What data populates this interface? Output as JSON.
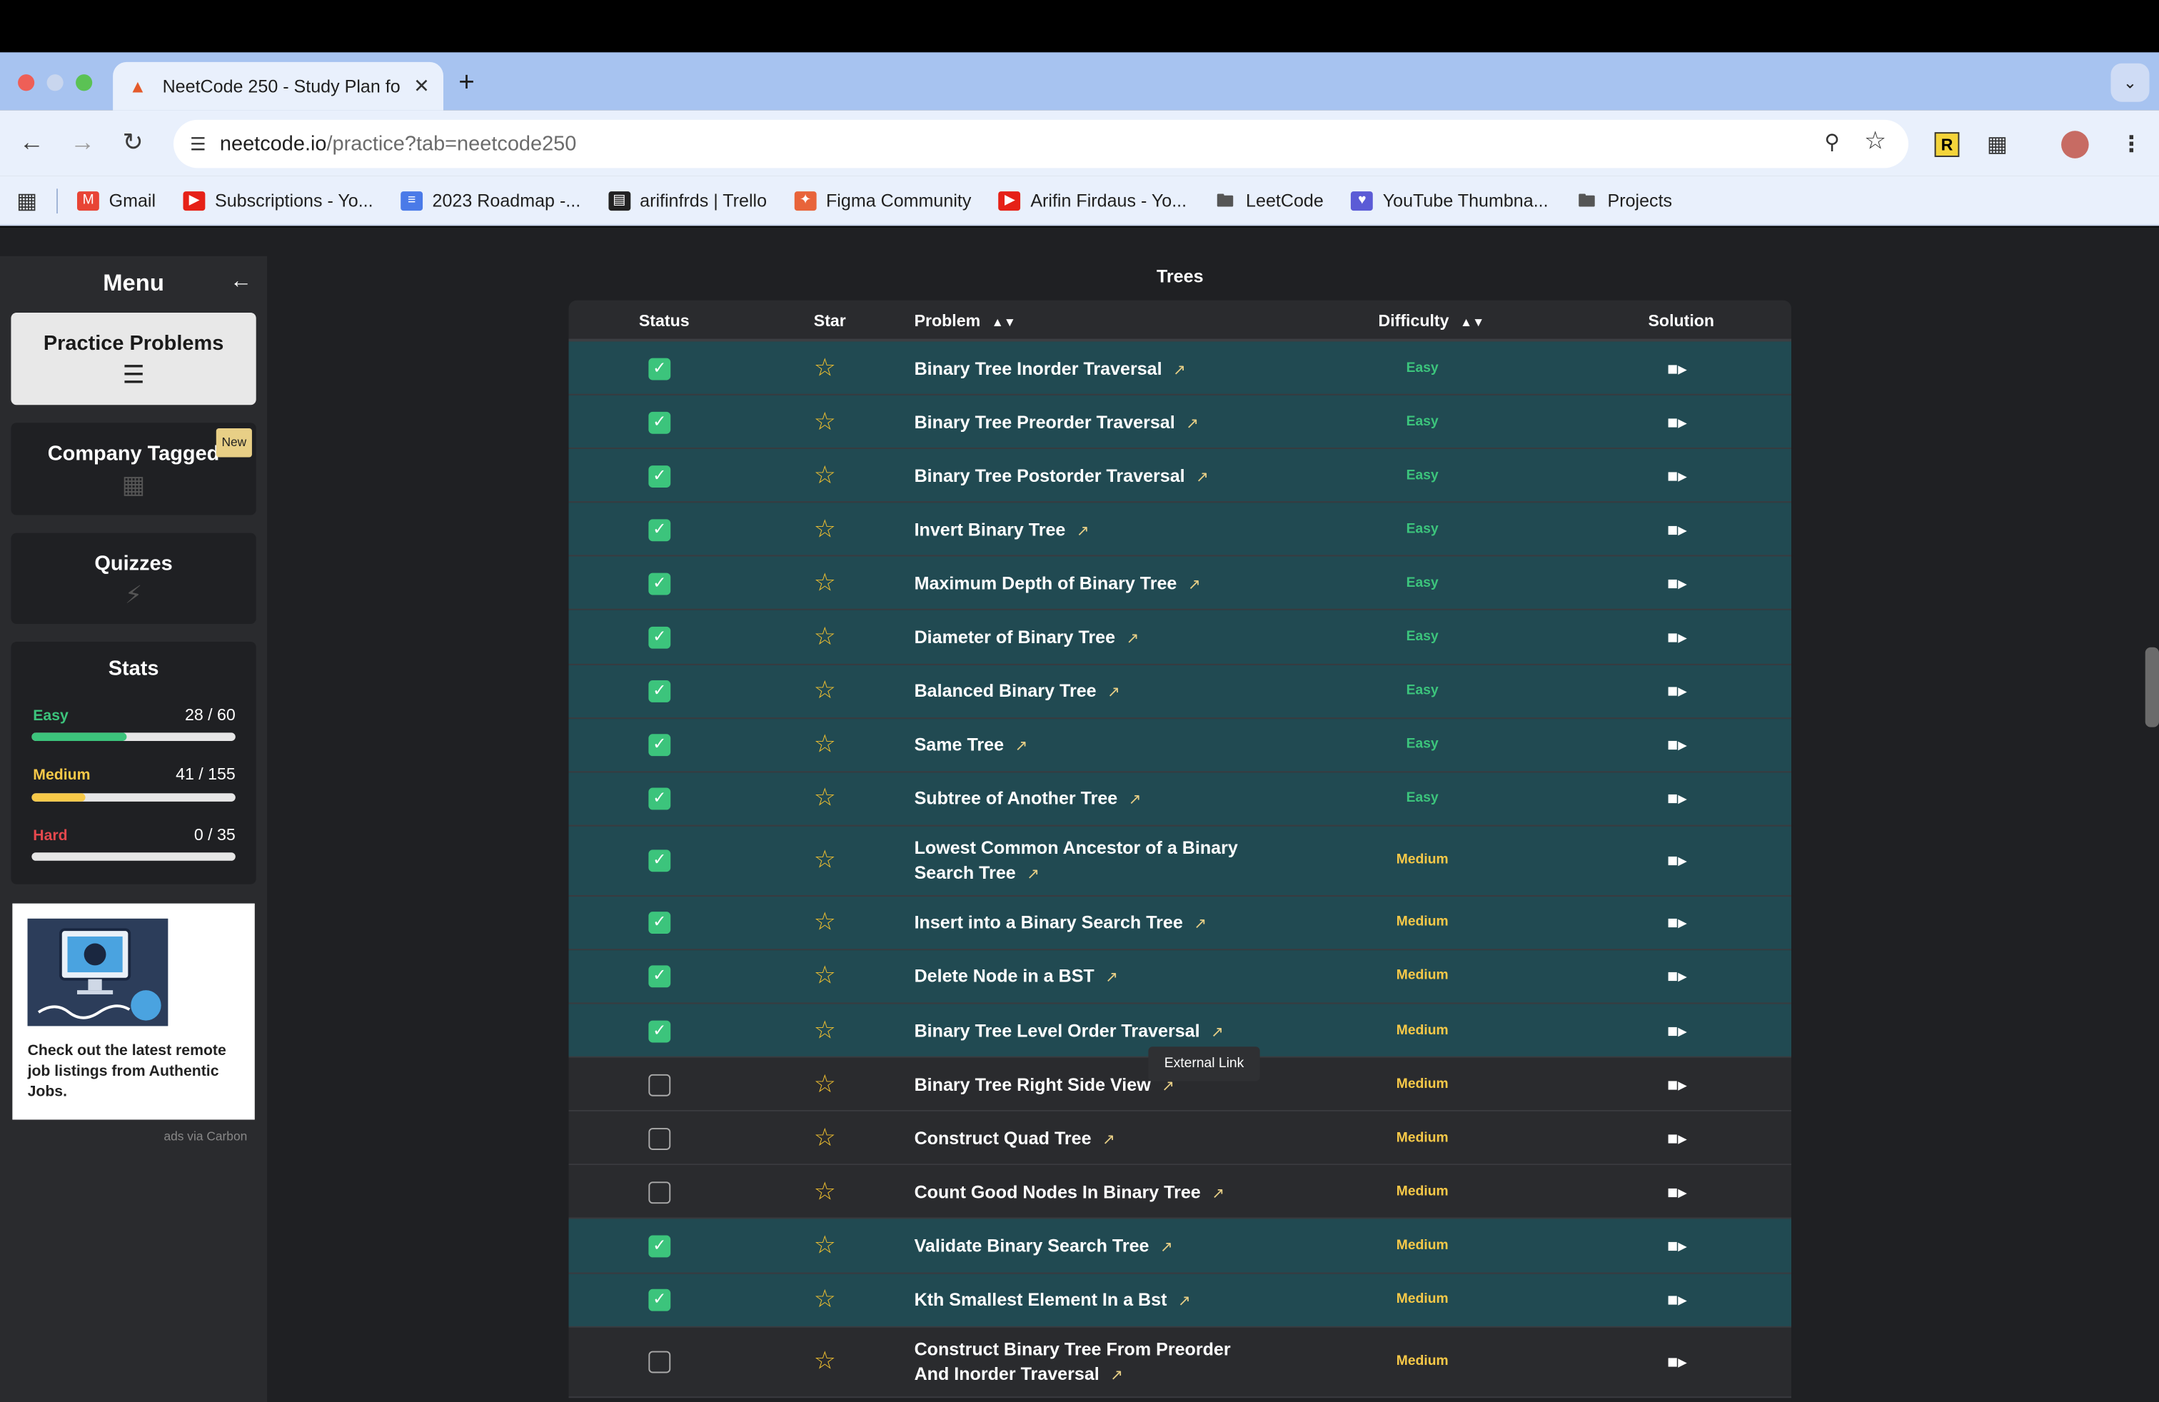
{
  "browser": {
    "tab_title": "NeetCode 250 - Study Plan fo",
    "url_domain": "neetcode.io",
    "url_path": "/practice?tab=neetcode250",
    "bookmarks": [
      {
        "label": "Gmail",
        "icon": "gmail-icon",
        "color": "#e84435"
      },
      {
        "label": "Subscriptions - Yo...",
        "icon": "youtube-icon",
        "color": "#e62117"
      },
      {
        "label": "2023 Roadmap -...",
        "icon": "docs-icon",
        "color": "#4a7ae8"
      },
      {
        "label": "arifinfrds | Trello",
        "icon": "trello-icon",
        "color": "#222"
      },
      {
        "label": "Figma Community",
        "icon": "figma-icon",
        "color": "#e8643a"
      },
      {
        "label": "Arifin Firdaus - Yo...",
        "icon": "youtube-icon",
        "color": "#e62117"
      },
      {
        "label": "LeetCode",
        "icon": "folder-icon",
        "color": "#555"
      },
      {
        "label": "YouTube Thumbna...",
        "icon": "heart-icon",
        "color": "#5b5bd6"
      },
      {
        "label": "Projects",
        "icon": "folder-icon",
        "color": "#555"
      }
    ]
  },
  "sidebar": {
    "title": "Menu",
    "items": [
      {
        "label": "Practice Problems",
        "icon": "list-icon"
      },
      {
        "label": "Company Tagged",
        "icon": "building-icon",
        "badge": "New"
      },
      {
        "label": "Quizzes",
        "icon": "lightning-icon"
      }
    ],
    "stats": {
      "title": "Stats",
      "easy": {
        "label": "Easy",
        "count": "28 / 60",
        "solved": 28,
        "total": 60,
        "color": "#3cc47c"
      },
      "medium": {
        "label": "Medium",
        "count": "41 / 155",
        "solved": 41,
        "total": 155,
        "color": "#f7c948"
      },
      "hard": {
        "label": "Hard",
        "count": "0 / 35",
        "solved": 0,
        "total": 35,
        "color": "#e5484d"
      }
    },
    "ad": {
      "text": "Check out the latest remote job listings from Authentic Jobs.",
      "credit": "ads via Carbon"
    }
  },
  "table": {
    "section_title": "Trees",
    "headers": {
      "status": "Status",
      "star": "Star",
      "problem": "Problem",
      "difficulty": "Difficulty",
      "solution": "Solution"
    },
    "rows": [
      {
        "problem": "Binary Tree Inorder Traversal",
        "difficulty": "Easy",
        "done": true
      },
      {
        "problem": "Binary Tree Preorder Traversal",
        "difficulty": "Easy",
        "done": true
      },
      {
        "problem": "Binary Tree Postorder Traversal",
        "difficulty": "Easy",
        "done": true
      },
      {
        "problem": "Invert Binary Tree",
        "difficulty": "Easy",
        "done": true
      },
      {
        "problem": "Maximum Depth of Binary Tree",
        "difficulty": "Easy",
        "done": true
      },
      {
        "problem": "Diameter of Binary Tree",
        "difficulty": "Easy",
        "done": true
      },
      {
        "problem": "Balanced Binary Tree",
        "difficulty": "Easy",
        "done": true
      },
      {
        "problem": "Same Tree",
        "difficulty": "Easy",
        "done": true
      },
      {
        "problem": "Subtree of Another Tree",
        "difficulty": "Easy",
        "done": true
      },
      {
        "problem": "Lowest Common Ancestor of a Binary Search Tree",
        "difficulty": "Medium",
        "done": true,
        "tall": true
      },
      {
        "problem": "Insert into a Binary Search Tree",
        "difficulty": "Medium",
        "done": true
      },
      {
        "problem": "Delete Node in a BST",
        "difficulty": "Medium",
        "done": true
      },
      {
        "problem": "Binary Tree Level Order Traversal",
        "difficulty": "Medium",
        "done": true
      },
      {
        "problem": "Binary Tree Right Side View",
        "difficulty": "Medium",
        "done": false
      },
      {
        "problem": "Construct Quad Tree",
        "difficulty": "Medium",
        "done": false
      },
      {
        "problem": "Count Good Nodes In Binary Tree",
        "difficulty": "Medium",
        "done": false
      },
      {
        "problem": "Validate Binary Search Tree",
        "difficulty": "Medium",
        "done": true
      },
      {
        "problem": "Kth Smallest Element In a Bst",
        "difficulty": "Medium",
        "done": true
      },
      {
        "problem": "Construct Binary Tree From Preorder And Inorder Traversal",
        "difficulty": "Medium",
        "done": false,
        "tall": true
      }
    ],
    "tooltip": "External Link"
  }
}
